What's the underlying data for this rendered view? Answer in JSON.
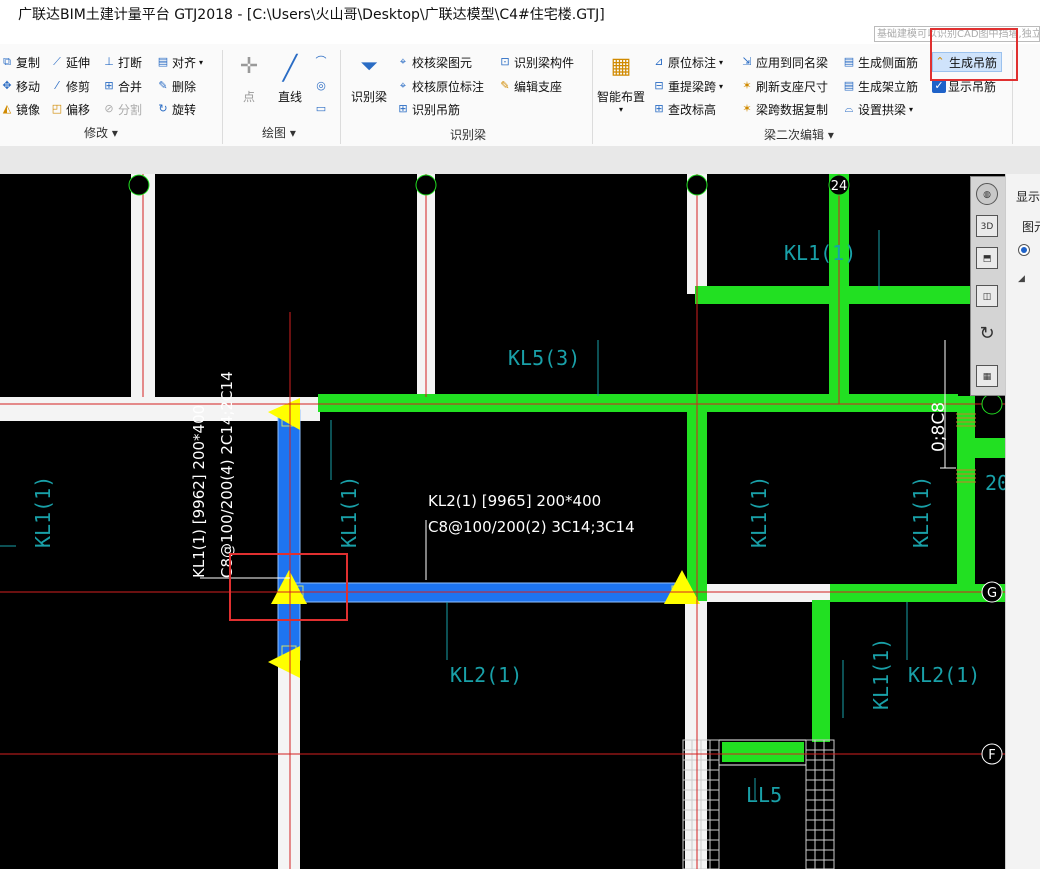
{
  "window": {
    "title": "广联达BIM土建计量平台 GTJ2018 - [C:\\Users\\火山哥\\Desktop\\广联达模型\\C4#住宅楼.GTJ]",
    "search_placeholder": "基础建模可以识别CAD图中挡墙,独立基础"
  },
  "ribbon": {
    "modify": {
      "items": [
        "复制",
        "延伸",
        "打断",
        "对齐",
        "移动",
        "修剪",
        "合并",
        "删除",
        "镜像",
        "偏移",
        "分割",
        "旋转"
      ],
      "group_label": "修改"
    },
    "draw": {
      "point_label": "点",
      "line_label": "直线",
      "group_label": "绘图"
    },
    "identify_beam": {
      "big_label": "识别梁",
      "items": [
        "校核梁图元",
        "识别梁构件",
        "校核原位标注",
        "编辑支座",
        "识别吊筋"
      ],
      "group_label": "识别梁"
    },
    "beam_edit": {
      "smart_layout_label": "智能布置",
      "items": [
        "原位标注",
        "应用到同名梁",
        "生成侧面筋",
        "生成吊筋",
        "重提梁跨",
        "刷新支座尺寸",
        "生成架立筋",
        "显示吊筋",
        "查改标高",
        "梁跨数据复制",
        "设置拱梁"
      ],
      "group_label": "梁二次编辑"
    }
  },
  "right_panel": {
    "display_label": "显示",
    "tu_label": "图元"
  },
  "canvas": {
    "axis_labels": [
      "24",
      "G",
      "F"
    ],
    "annotations": {
      "kl1_long": "KL1(1) [9962] 200*400",
      "kl1_rebar": "C8@100/200(4) 2C14;2C14",
      "kl2_long": "KL2(1) [9965] 200*400",
      "kl2_rebar": "C8@100/200(2) 3C14;3C14",
      "hanger": "0;8C8",
      "cut_20": "20"
    },
    "beam_labels": [
      "KL1(1)",
      "KL5(3)",
      "KL1(1)",
      "KL1(1)",
      "KL1(1)",
      "KL1(1)",
      "KL2(1)",
      "KL1(1)",
      "KL2(1)",
      "LL5"
    ],
    "colors": {
      "background": "#000000",
      "beam_green": "#22e022",
      "selected_blue": "#1e74f0",
      "column_white": "#f4f4f4",
      "axis_red": "#d42020",
      "label_cyan": "#19a0a8",
      "marker_yellow": "#ffff00",
      "highlight_red": "#e03030"
    }
  }
}
